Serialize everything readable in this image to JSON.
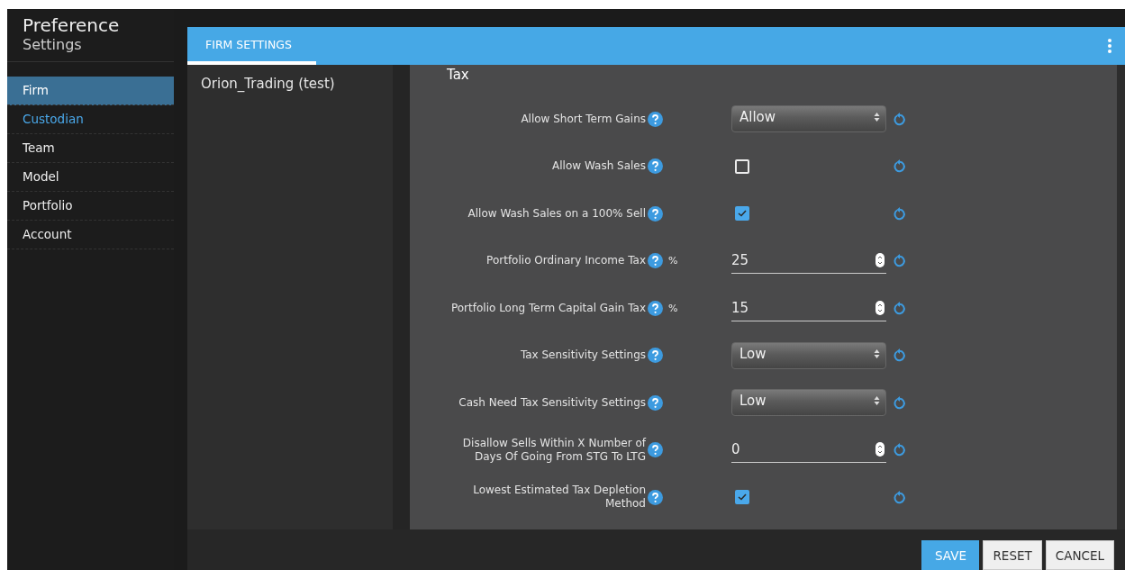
{
  "sidebar": {
    "title": "Preference",
    "subtitle": "Settings",
    "items": [
      {
        "label": "Firm",
        "selected": true,
        "hovered": false
      },
      {
        "label": "Custodian",
        "selected": false,
        "hovered": true
      },
      {
        "label": "Team",
        "selected": false,
        "hovered": false
      },
      {
        "label": "Model",
        "selected": false,
        "hovered": false
      },
      {
        "label": "Portfolio",
        "selected": false,
        "hovered": false
      },
      {
        "label": "Account",
        "selected": false,
        "hovered": false
      }
    ]
  },
  "tabs": [
    {
      "label": "FIRM SETTINGS",
      "selected": true
    }
  ],
  "firms": [
    {
      "label": "Orion_Trading (test)"
    }
  ],
  "section": {
    "title": "Tax",
    "rows": [
      {
        "kind": "select",
        "label": "Allow Short Term Gains",
        "value": "Allow"
      },
      {
        "kind": "checkbox",
        "label": "Allow Wash Sales",
        "checked": false
      },
      {
        "kind": "checkbox",
        "label": "Allow Wash Sales on a 100% Sell",
        "checked": true
      },
      {
        "kind": "number",
        "label": "Portfolio Ordinary Income Tax",
        "unit": "%",
        "value": "25"
      },
      {
        "kind": "number",
        "label": "Portfolio Long Term Capital Gain Tax",
        "unit": "%",
        "value": "15"
      },
      {
        "kind": "select",
        "label": "Tax Sensitivity Settings",
        "value": "Low"
      },
      {
        "kind": "select",
        "label": "Cash Need Tax Sensitivity Settings",
        "value": "Low"
      },
      {
        "kind": "number",
        "label": "Disallow Sells Within X Number of Days Of Going From STG To LTG",
        "value": "0"
      },
      {
        "kind": "checkbox",
        "label": "Lowest Estimated Tax Depletion Method",
        "checked": true
      }
    ]
  },
  "buttons": [
    {
      "label": "SAVE",
      "kind": "primary"
    },
    {
      "label": "RESET",
      "kind": "secondary"
    },
    {
      "label": "CANCEL",
      "kind": "secondary"
    }
  ]
}
